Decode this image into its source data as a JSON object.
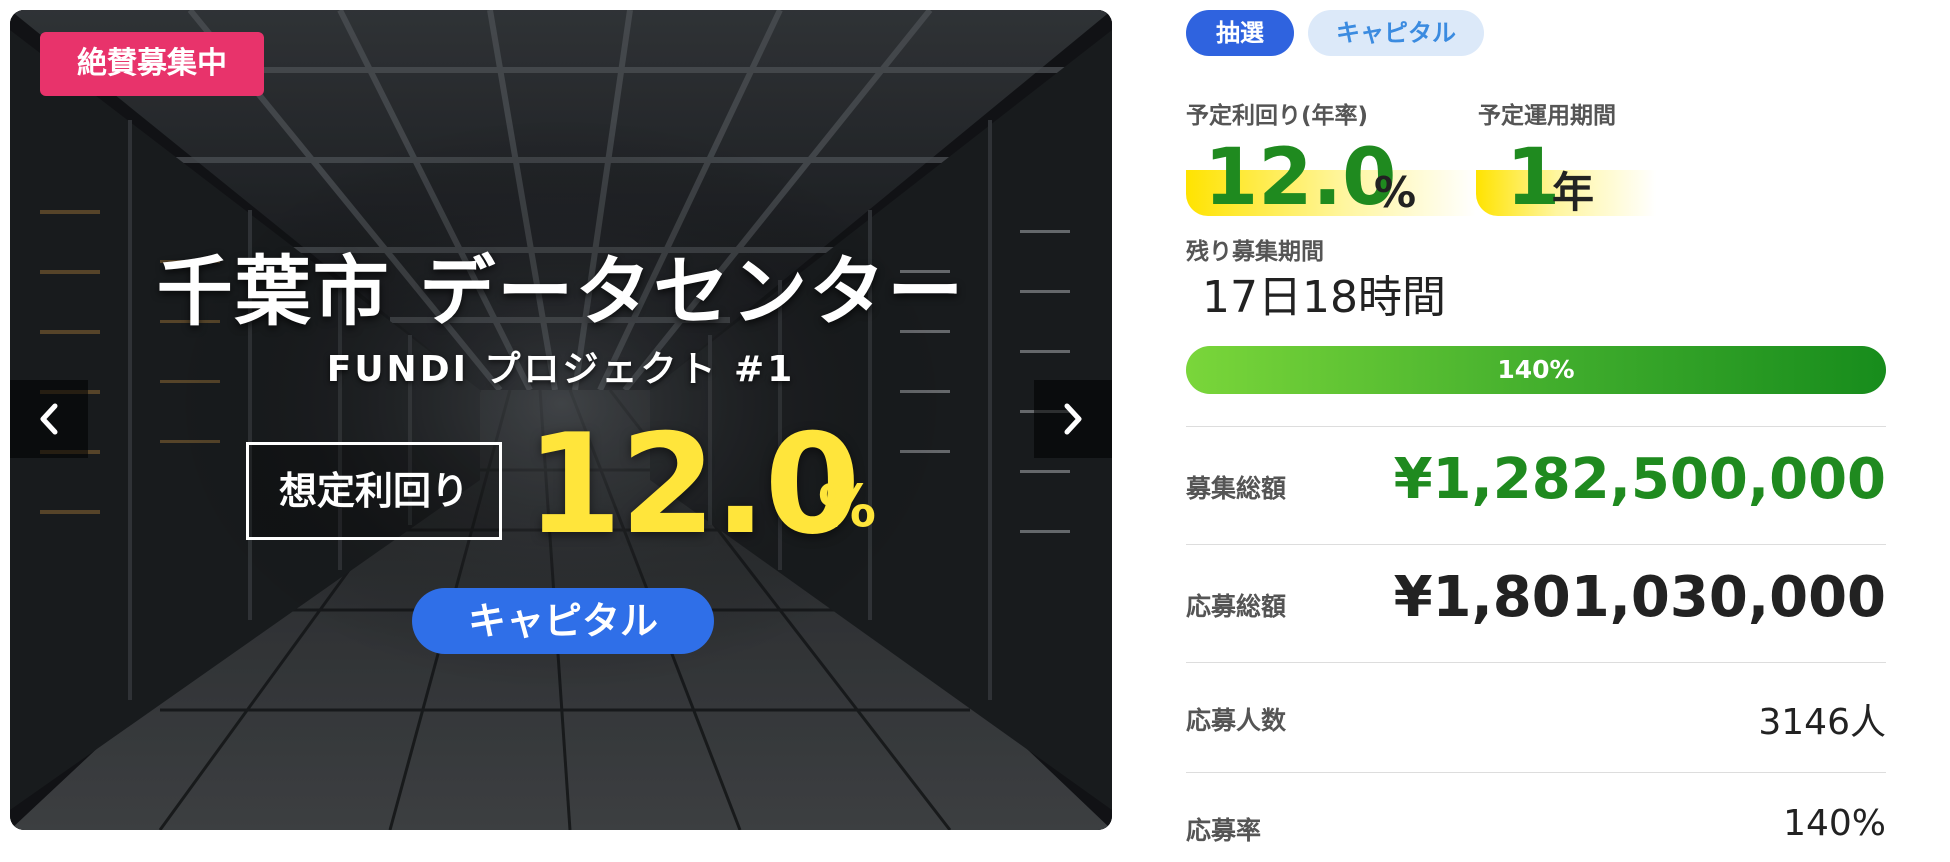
{
  "hero": {
    "badge": "絶賛募集中",
    "title": "千葉市 データセンター",
    "subtitle": "FUNDI プロジェクト #1",
    "yield_label": "想定利回り",
    "yield_value": "12.0",
    "yield_unit": "%",
    "pill": "キャピタル"
  },
  "tags": {
    "lottery": "抽選",
    "capital": "キャピタル"
  },
  "metrics": {
    "yield_label": "予定利回り(年率)",
    "yield_value": "12.0",
    "yield_unit": "%",
    "period_label": "予定運用期間",
    "period_value": "1",
    "period_unit": "年"
  },
  "remaining": {
    "label": "残り募集期間",
    "value": "17日18時間"
  },
  "progress": {
    "percent": 140,
    "label": "140%"
  },
  "stats": {
    "target_label": "募集総額",
    "target_value": "¥1,282,500,000",
    "applied_label": "応募総額",
    "applied_value": "¥1,801,030,000",
    "applicants_label": "応募人数",
    "applicants_value": "3146人",
    "rate_label": "応募率",
    "rate_value": "140%"
  },
  "colors": {
    "badge": "#e8336b",
    "accent_blue": "#2f63df",
    "accent_green": "#1f8a1f",
    "hero_yellow": "#ffe53b"
  },
  "icons": {
    "prev": "chevron-left-icon",
    "next": "chevron-right-icon"
  }
}
